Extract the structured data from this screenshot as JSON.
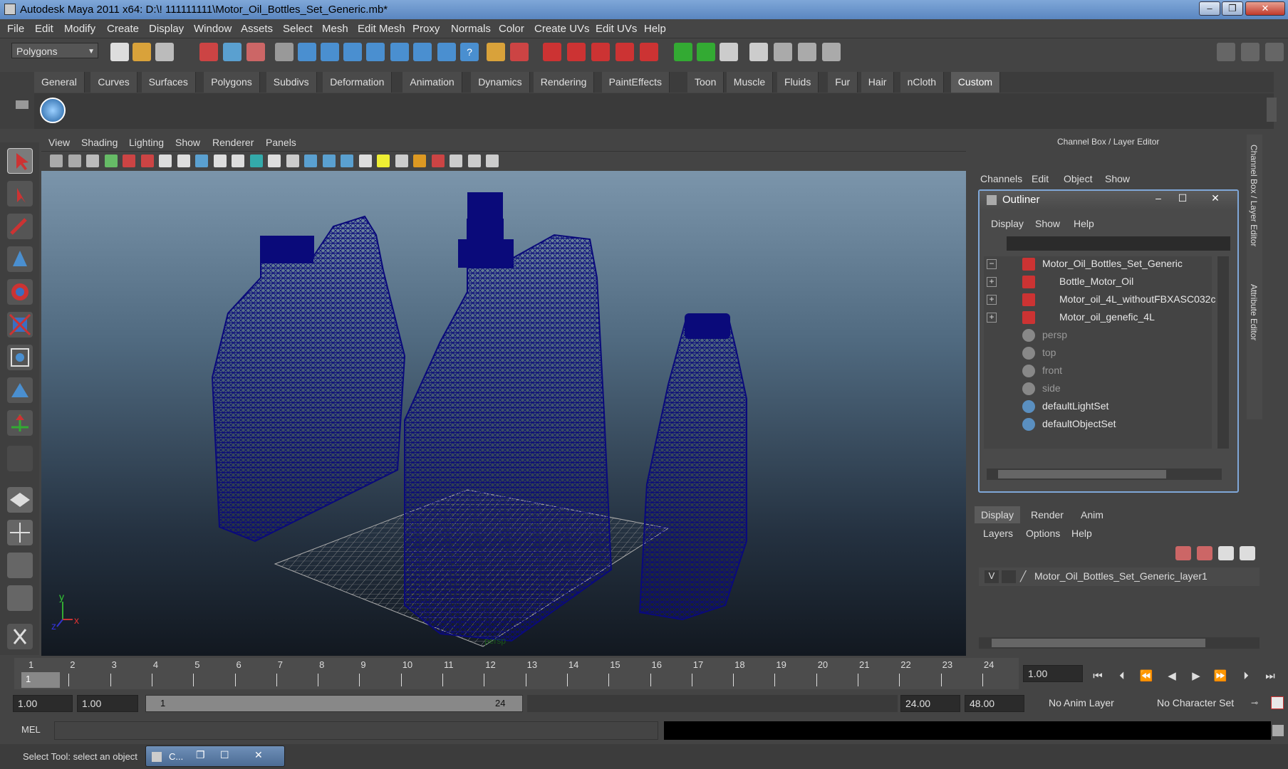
{
  "window": {
    "title": "Autodesk Maya 2011 x64: D:\\! 111111111\\Motor_Oil_Bottles_Set_Generic.mb*",
    "minimize": "–",
    "maximize": "❐",
    "close": "✕"
  },
  "menubar": [
    "File",
    "Edit",
    "Modify",
    "Create",
    "Display",
    "Window",
    "Assets",
    "Select",
    "Mesh",
    "Edit Mesh",
    "Proxy",
    "Normals",
    "Color",
    "Create UVs",
    "Edit UVs",
    "Help"
  ],
  "status": {
    "menuset": "Polygons"
  },
  "shelf": {
    "tabs": [
      "General",
      "Curves",
      "Surfaces",
      "Polygons",
      "Subdivs",
      "Deformation",
      "Animation",
      "Dynamics",
      "Rendering",
      "PaintEffects",
      "Toon",
      "Muscle",
      "Fluids",
      "Fur",
      "Hair",
      "nCloth",
      "Custom"
    ],
    "active": "Custom"
  },
  "viewport": {
    "menu": [
      "View",
      "Shading",
      "Lighting",
      "Show",
      "Renderer",
      "Panels"
    ],
    "camera_label": "persp",
    "axis": {
      "x": "x",
      "y": "y",
      "z": "z"
    }
  },
  "channelbox": {
    "title": "Channel Box / Layer Editor",
    "menu": [
      "Channels",
      "Edit",
      "Object",
      "Show"
    ],
    "side_tab_1": "Channel Box / Layer Editor",
    "side_tab_2": "Attribute Editor"
  },
  "outliner": {
    "title": "Outliner",
    "menu": [
      "Display",
      "Show",
      "Help"
    ],
    "items": [
      {
        "label": "Motor_Oil_Bottles_Set_Generic",
        "expander": "−",
        "type": "mesh",
        "indent": 0,
        "dim": false
      },
      {
        "label": "Bottle_Motor_Oil",
        "expander": "+",
        "type": "mesh",
        "indent": 1,
        "dim": false
      },
      {
        "label": "Motor_oil_4L_withoutFBXASC032c",
        "expander": "+",
        "type": "mesh",
        "indent": 1,
        "dim": false
      },
      {
        "label": "Motor_oil_genefic_4L",
        "expander": "+",
        "type": "mesh",
        "indent": 1,
        "dim": false
      },
      {
        "label": "persp",
        "expander": "",
        "type": "camera",
        "indent": 0,
        "dim": true
      },
      {
        "label": "top",
        "expander": "",
        "type": "camera",
        "indent": 0,
        "dim": true
      },
      {
        "label": "front",
        "expander": "",
        "type": "camera",
        "indent": 0,
        "dim": true
      },
      {
        "label": "side",
        "expander": "",
        "type": "camera",
        "indent": 0,
        "dim": true
      },
      {
        "label": "defaultLightSet",
        "expander": "",
        "type": "set",
        "indent": 0,
        "dim": false
      },
      {
        "label": "defaultObjectSet",
        "expander": "",
        "type": "set",
        "indent": 0,
        "dim": false
      }
    ]
  },
  "layers": {
    "tabs": [
      "Display",
      "Render",
      "Anim"
    ],
    "active": "Display",
    "menu": [
      "Layers",
      "Options",
      "Help"
    ],
    "layer": {
      "visible": "V",
      "name": "Motor_Oil_Bottles_Set_Generic_layer1"
    }
  },
  "timeline": {
    "ticks": [
      "1",
      "2",
      "3",
      "4",
      "5",
      "6",
      "7",
      "8",
      "9",
      "10",
      "11",
      "12",
      "13",
      "14",
      "15",
      "16",
      "17",
      "18",
      "19",
      "20",
      "21",
      "22",
      "23",
      "24"
    ],
    "current_marker": "1",
    "current_time": "1.00"
  },
  "range": {
    "start": "1.00",
    "start2": "1.00",
    "slider_start": "1",
    "slider_end": "24",
    "end": "24.00",
    "end2": "48.00",
    "anim_layer": "No Anim Layer",
    "character_set": "No Character Set"
  },
  "mel": {
    "label": "MEL"
  },
  "help": {
    "text": "Select Tool: select an object",
    "minimized_window": "C..."
  },
  "colors": {
    "wireframe": "#0a0a7a",
    "accent": "#7fa7d8"
  }
}
